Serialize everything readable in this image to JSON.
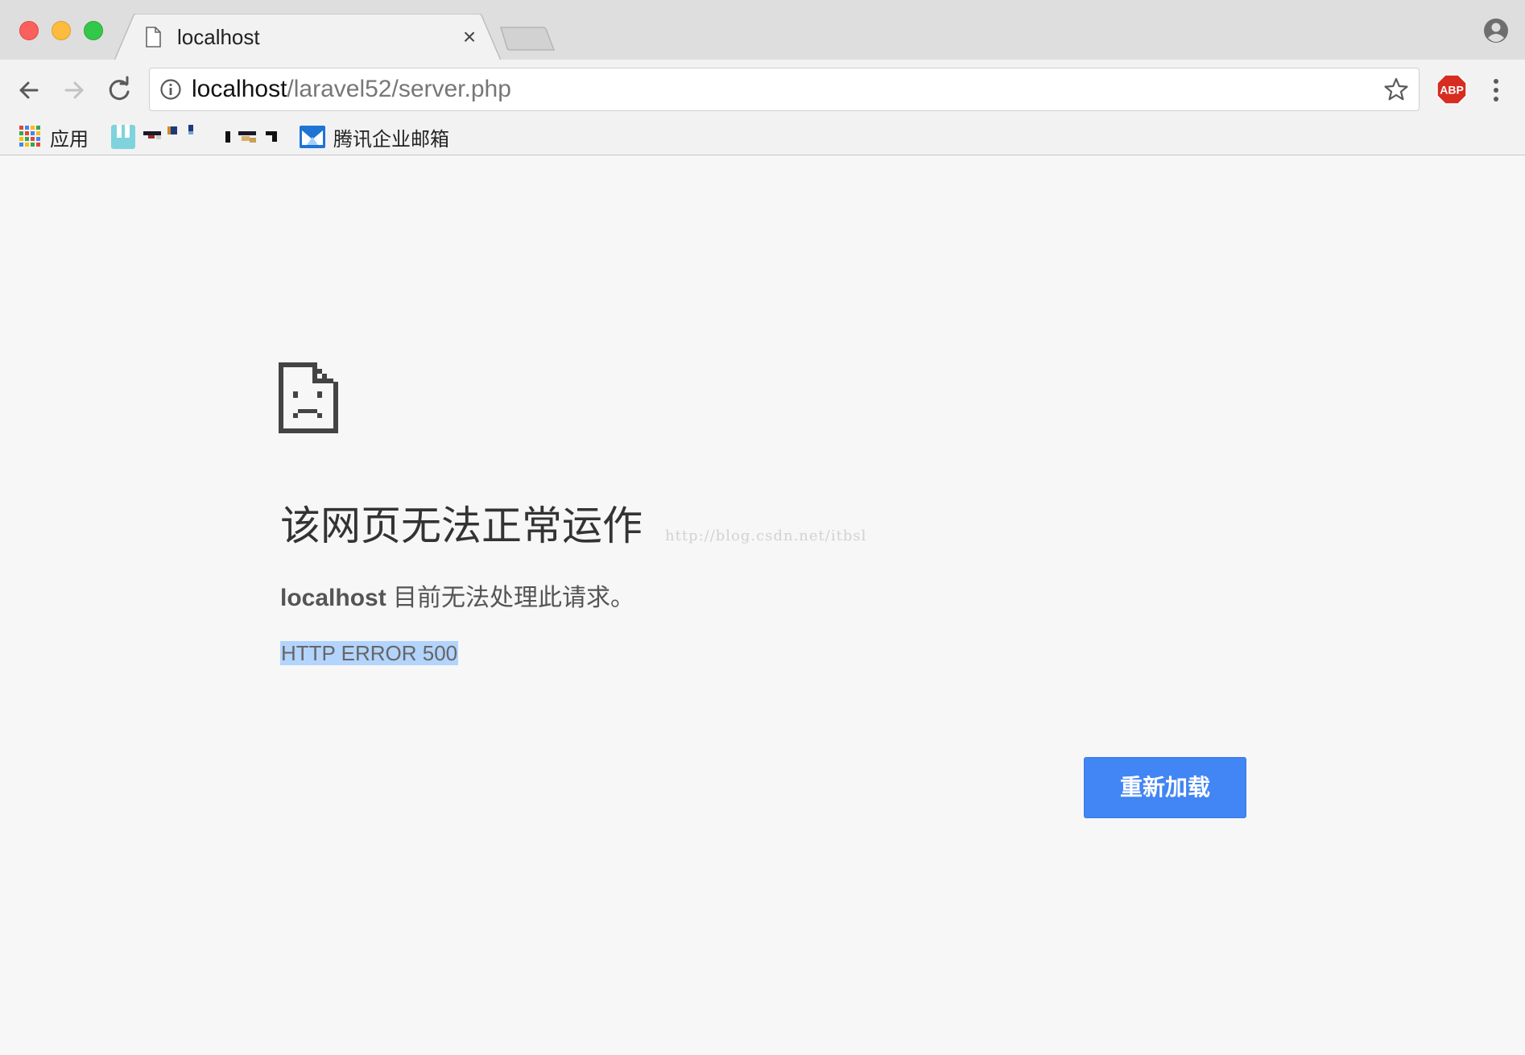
{
  "window": {
    "controls": [
      "close",
      "minimize",
      "maximize"
    ]
  },
  "tab": {
    "title": "localhost",
    "icon": "document-icon",
    "close_glyph": "×"
  },
  "toolbar": {
    "url_host": "localhost",
    "url_path": "/laravel52/server.php",
    "extension_icon": "adblock-plus-icon",
    "extension_label": "ABP"
  },
  "bookmarks": {
    "apps_label": "应用",
    "mail_label": "腾讯企业邮箱"
  },
  "error_page": {
    "heading": "该网页无法正常运作",
    "host": "localhost",
    "message": "目前无法处理此请求。",
    "error_code": "HTTP ERROR 500",
    "reload_button": "重新加载",
    "watermark": "http://blog.csdn.net/itbsl"
  },
  "colors": {
    "accent": "#4285f4",
    "page_background": "#f7f7f7",
    "selection": "#b3d4fc",
    "abp_red": "#d62d20"
  }
}
